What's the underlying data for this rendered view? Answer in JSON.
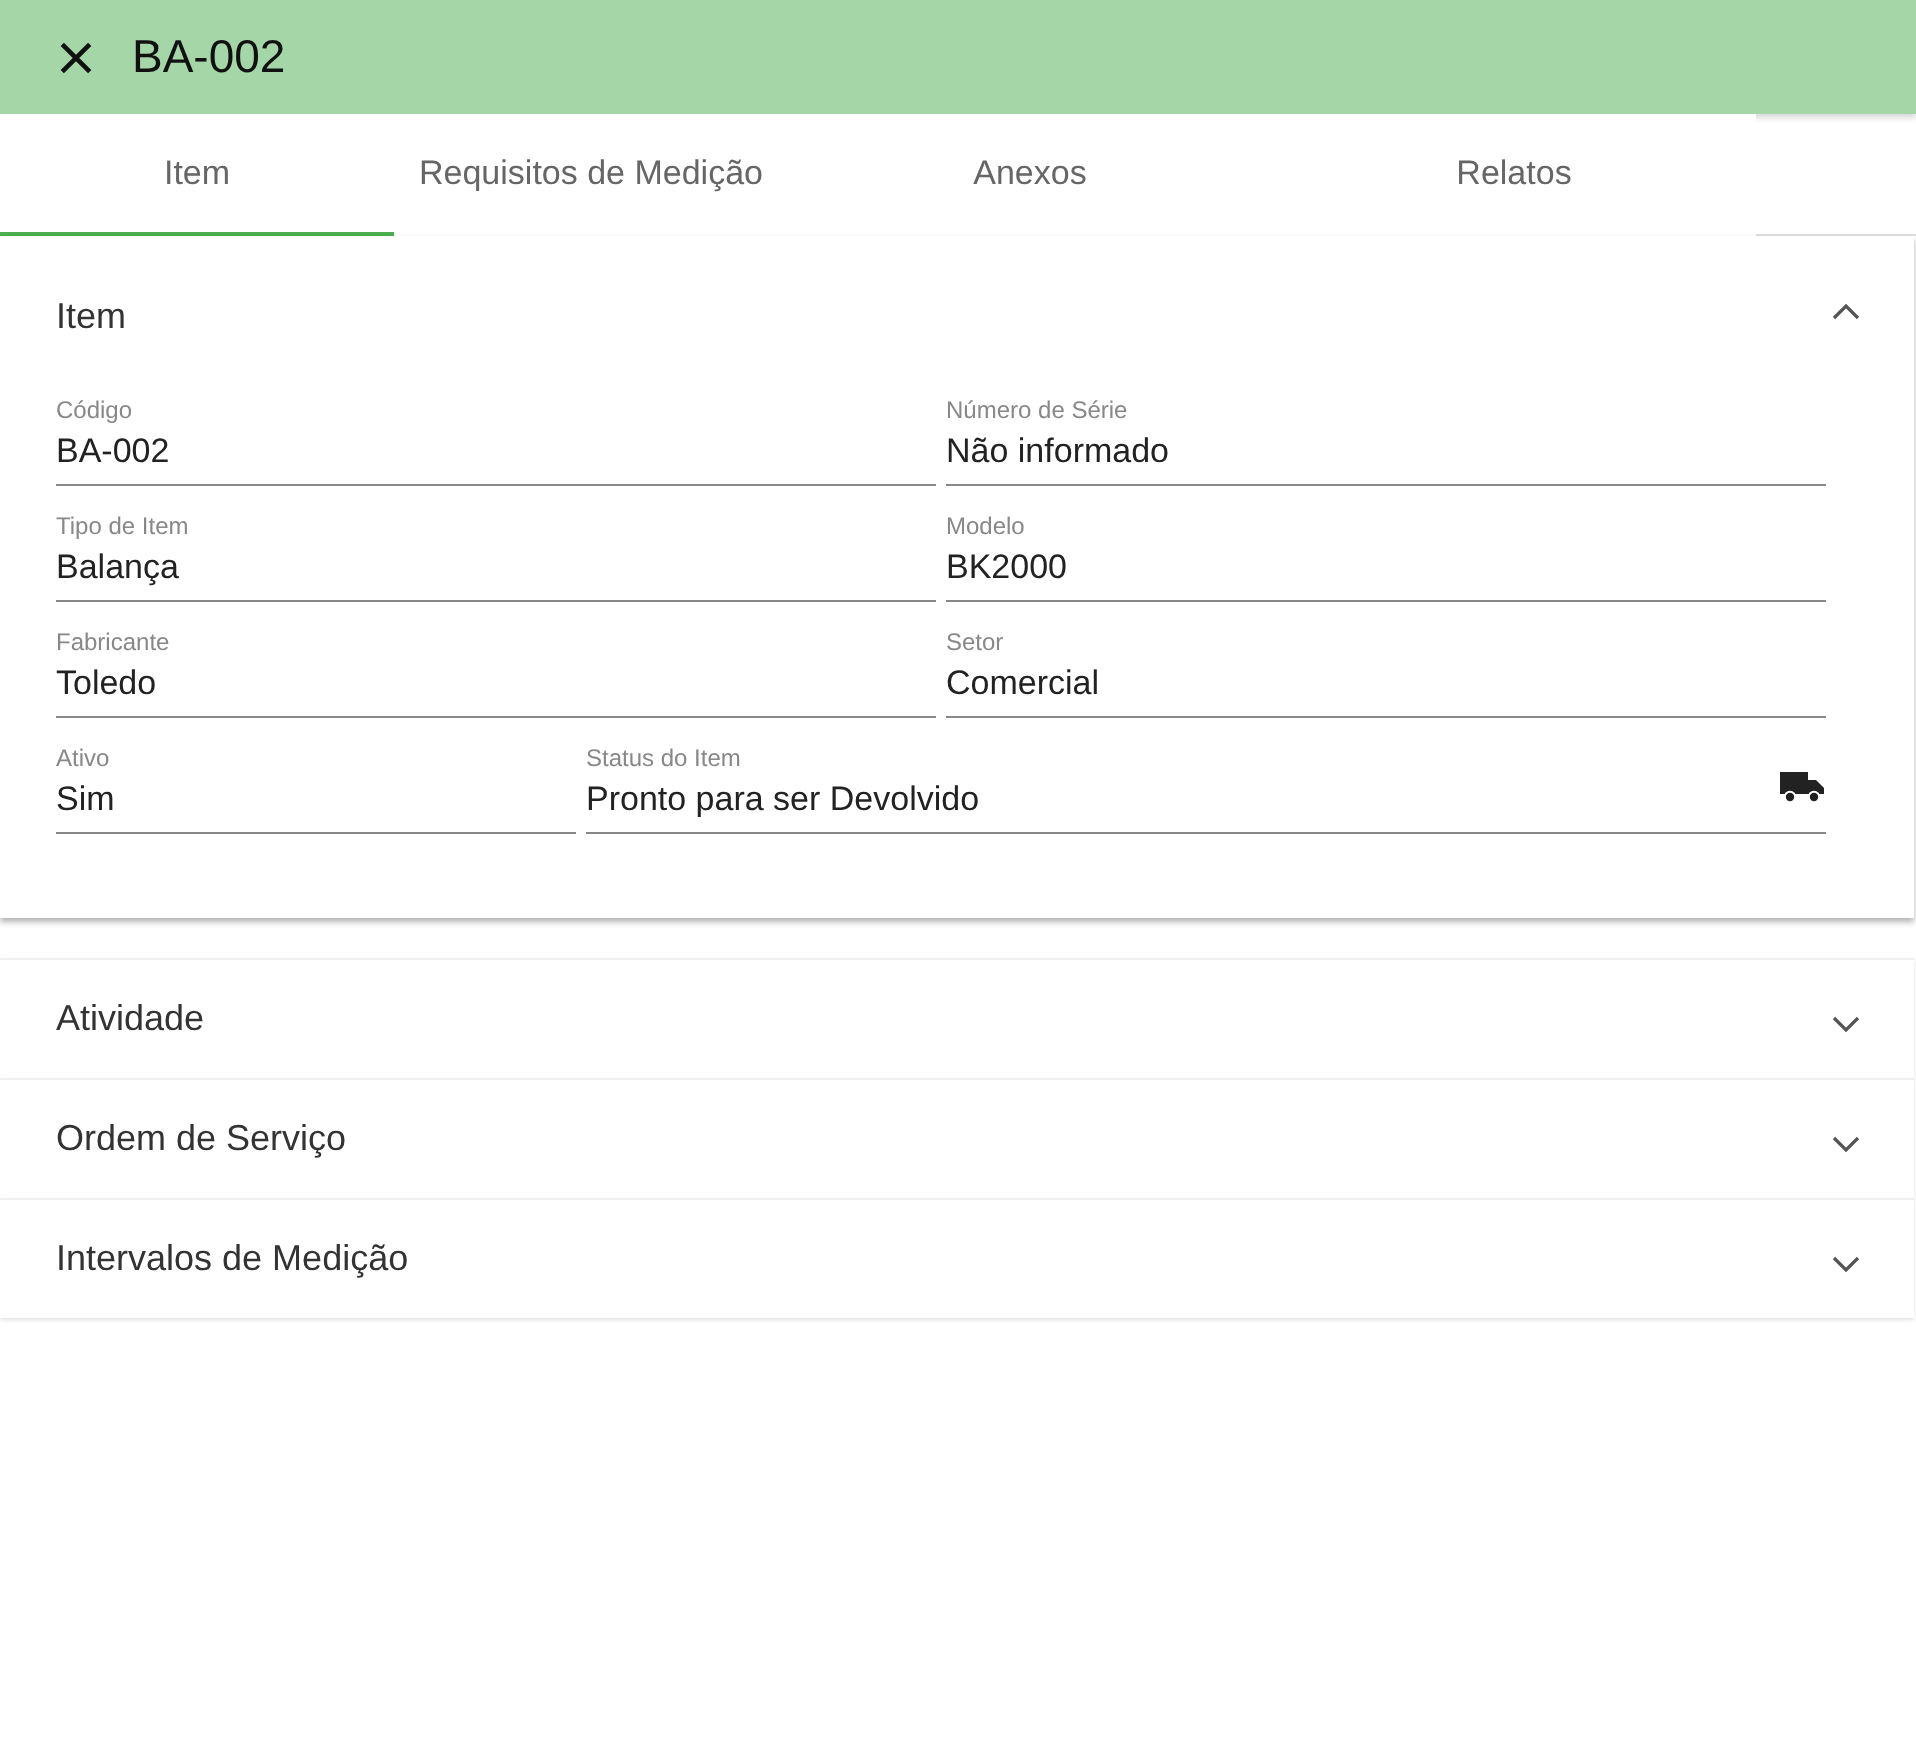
{
  "header": {
    "title": "BA-002"
  },
  "tabs": [
    {
      "label": "Item",
      "selected": true
    },
    {
      "label": "Requisitos de Medição",
      "selected": false
    },
    {
      "label": "Anexos",
      "selected": false
    },
    {
      "label": "Relatos",
      "selected": false
    }
  ],
  "panels": [
    {
      "title": "Item",
      "expanded": true,
      "rows": [
        [
          {
            "kind": "text",
            "label": "Código",
            "value": "BA-002"
          },
          {
            "kind": "text",
            "label": "Número de Série",
            "value": "Não informado"
          }
        ],
        [
          {
            "kind": "text",
            "label": "Tipo de Item",
            "value": "Balança"
          },
          {
            "kind": "text",
            "label": "Modelo",
            "value": "BK2000"
          }
        ],
        [
          {
            "kind": "text",
            "label": "Fabricante",
            "value": "Toledo"
          },
          {
            "kind": "text",
            "label": "Setor",
            "value": "Comercial"
          }
        ],
        [
          {
            "kind": "text",
            "label": "Ativo",
            "value": "Sim"
          },
          {
            "kind": "status",
            "label": "Status do Item",
            "value": "Pronto para ser Devolvido"
          }
        ]
      ]
    },
    {
      "title": "Atividade",
      "expanded": false
    },
    {
      "title": "Ordem de Serviço",
      "expanded": false
    },
    {
      "title": "Intervalos de Medição",
      "expanded": false
    }
  ]
}
